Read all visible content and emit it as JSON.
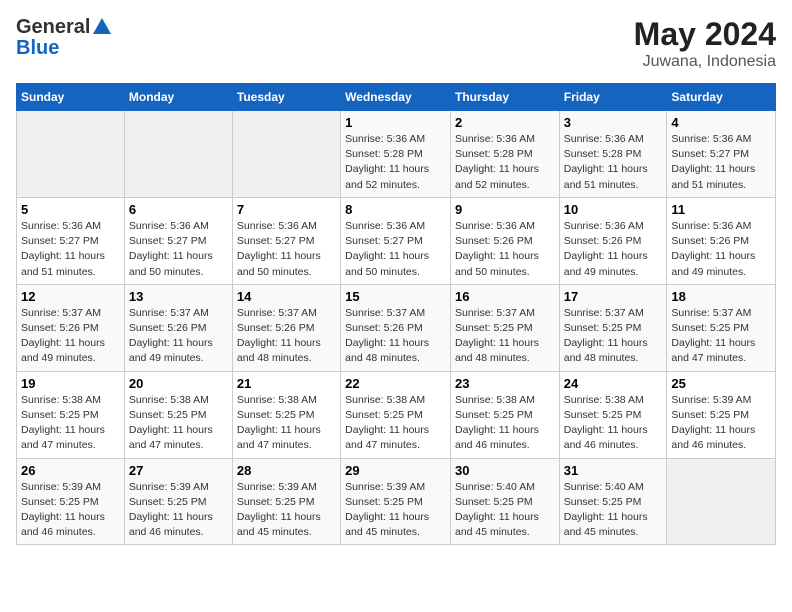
{
  "header": {
    "logo_general": "General",
    "logo_blue": "Blue",
    "month": "May 2024",
    "location": "Juwana, Indonesia"
  },
  "weekdays": [
    "Sunday",
    "Monday",
    "Tuesday",
    "Wednesday",
    "Thursday",
    "Friday",
    "Saturday"
  ],
  "weeks": [
    [
      {
        "day": "",
        "sunrise": "",
        "sunset": "",
        "daylight": "",
        "empty": true
      },
      {
        "day": "",
        "sunrise": "",
        "sunset": "",
        "daylight": "",
        "empty": true
      },
      {
        "day": "",
        "sunrise": "",
        "sunset": "",
        "daylight": "",
        "empty": true
      },
      {
        "day": "1",
        "sunrise": "Sunrise: 5:36 AM",
        "sunset": "Sunset: 5:28 PM",
        "daylight": "Daylight: 11 hours and 52 minutes."
      },
      {
        "day": "2",
        "sunrise": "Sunrise: 5:36 AM",
        "sunset": "Sunset: 5:28 PM",
        "daylight": "Daylight: 11 hours and 52 minutes."
      },
      {
        "day": "3",
        "sunrise": "Sunrise: 5:36 AM",
        "sunset": "Sunset: 5:28 PM",
        "daylight": "Daylight: 11 hours and 51 minutes."
      },
      {
        "day": "4",
        "sunrise": "Sunrise: 5:36 AM",
        "sunset": "Sunset: 5:27 PM",
        "daylight": "Daylight: 11 hours and 51 minutes."
      }
    ],
    [
      {
        "day": "5",
        "sunrise": "Sunrise: 5:36 AM",
        "sunset": "Sunset: 5:27 PM",
        "daylight": "Daylight: 11 hours and 51 minutes."
      },
      {
        "day": "6",
        "sunrise": "Sunrise: 5:36 AM",
        "sunset": "Sunset: 5:27 PM",
        "daylight": "Daylight: 11 hours and 50 minutes."
      },
      {
        "day": "7",
        "sunrise": "Sunrise: 5:36 AM",
        "sunset": "Sunset: 5:27 PM",
        "daylight": "Daylight: 11 hours and 50 minutes."
      },
      {
        "day": "8",
        "sunrise": "Sunrise: 5:36 AM",
        "sunset": "Sunset: 5:27 PM",
        "daylight": "Daylight: 11 hours and 50 minutes."
      },
      {
        "day": "9",
        "sunrise": "Sunrise: 5:36 AM",
        "sunset": "Sunset: 5:26 PM",
        "daylight": "Daylight: 11 hours and 50 minutes."
      },
      {
        "day": "10",
        "sunrise": "Sunrise: 5:36 AM",
        "sunset": "Sunset: 5:26 PM",
        "daylight": "Daylight: 11 hours and 49 minutes."
      },
      {
        "day": "11",
        "sunrise": "Sunrise: 5:36 AM",
        "sunset": "Sunset: 5:26 PM",
        "daylight": "Daylight: 11 hours and 49 minutes."
      }
    ],
    [
      {
        "day": "12",
        "sunrise": "Sunrise: 5:37 AM",
        "sunset": "Sunset: 5:26 PM",
        "daylight": "Daylight: 11 hours and 49 minutes."
      },
      {
        "day": "13",
        "sunrise": "Sunrise: 5:37 AM",
        "sunset": "Sunset: 5:26 PM",
        "daylight": "Daylight: 11 hours and 49 minutes."
      },
      {
        "day": "14",
        "sunrise": "Sunrise: 5:37 AM",
        "sunset": "Sunset: 5:26 PM",
        "daylight": "Daylight: 11 hours and 48 minutes."
      },
      {
        "day": "15",
        "sunrise": "Sunrise: 5:37 AM",
        "sunset": "Sunset: 5:26 PM",
        "daylight": "Daylight: 11 hours and 48 minutes."
      },
      {
        "day": "16",
        "sunrise": "Sunrise: 5:37 AM",
        "sunset": "Sunset: 5:25 PM",
        "daylight": "Daylight: 11 hours and 48 minutes."
      },
      {
        "day": "17",
        "sunrise": "Sunrise: 5:37 AM",
        "sunset": "Sunset: 5:25 PM",
        "daylight": "Daylight: 11 hours and 48 minutes."
      },
      {
        "day": "18",
        "sunrise": "Sunrise: 5:37 AM",
        "sunset": "Sunset: 5:25 PM",
        "daylight": "Daylight: 11 hours and 47 minutes."
      }
    ],
    [
      {
        "day": "19",
        "sunrise": "Sunrise: 5:38 AM",
        "sunset": "Sunset: 5:25 PM",
        "daylight": "Daylight: 11 hours and 47 minutes."
      },
      {
        "day": "20",
        "sunrise": "Sunrise: 5:38 AM",
        "sunset": "Sunset: 5:25 PM",
        "daylight": "Daylight: 11 hours and 47 minutes."
      },
      {
        "day": "21",
        "sunrise": "Sunrise: 5:38 AM",
        "sunset": "Sunset: 5:25 PM",
        "daylight": "Daylight: 11 hours and 47 minutes."
      },
      {
        "day": "22",
        "sunrise": "Sunrise: 5:38 AM",
        "sunset": "Sunset: 5:25 PM",
        "daylight": "Daylight: 11 hours and 47 minutes."
      },
      {
        "day": "23",
        "sunrise": "Sunrise: 5:38 AM",
        "sunset": "Sunset: 5:25 PM",
        "daylight": "Daylight: 11 hours and 46 minutes."
      },
      {
        "day": "24",
        "sunrise": "Sunrise: 5:38 AM",
        "sunset": "Sunset: 5:25 PM",
        "daylight": "Daylight: 11 hours and 46 minutes."
      },
      {
        "day": "25",
        "sunrise": "Sunrise: 5:39 AM",
        "sunset": "Sunset: 5:25 PM",
        "daylight": "Daylight: 11 hours and 46 minutes."
      }
    ],
    [
      {
        "day": "26",
        "sunrise": "Sunrise: 5:39 AM",
        "sunset": "Sunset: 5:25 PM",
        "daylight": "Daylight: 11 hours and 46 minutes."
      },
      {
        "day": "27",
        "sunrise": "Sunrise: 5:39 AM",
        "sunset": "Sunset: 5:25 PM",
        "daylight": "Daylight: 11 hours and 46 minutes."
      },
      {
        "day": "28",
        "sunrise": "Sunrise: 5:39 AM",
        "sunset": "Sunset: 5:25 PM",
        "daylight": "Daylight: 11 hours and 45 minutes."
      },
      {
        "day": "29",
        "sunrise": "Sunrise: 5:39 AM",
        "sunset": "Sunset: 5:25 PM",
        "daylight": "Daylight: 11 hours and 45 minutes."
      },
      {
        "day": "30",
        "sunrise": "Sunrise: 5:40 AM",
        "sunset": "Sunset: 5:25 PM",
        "daylight": "Daylight: 11 hours and 45 minutes."
      },
      {
        "day": "31",
        "sunrise": "Sunrise: 5:40 AM",
        "sunset": "Sunset: 5:25 PM",
        "daylight": "Daylight: 11 hours and 45 minutes."
      },
      {
        "day": "",
        "sunrise": "",
        "sunset": "",
        "daylight": "",
        "empty": true
      }
    ]
  ]
}
